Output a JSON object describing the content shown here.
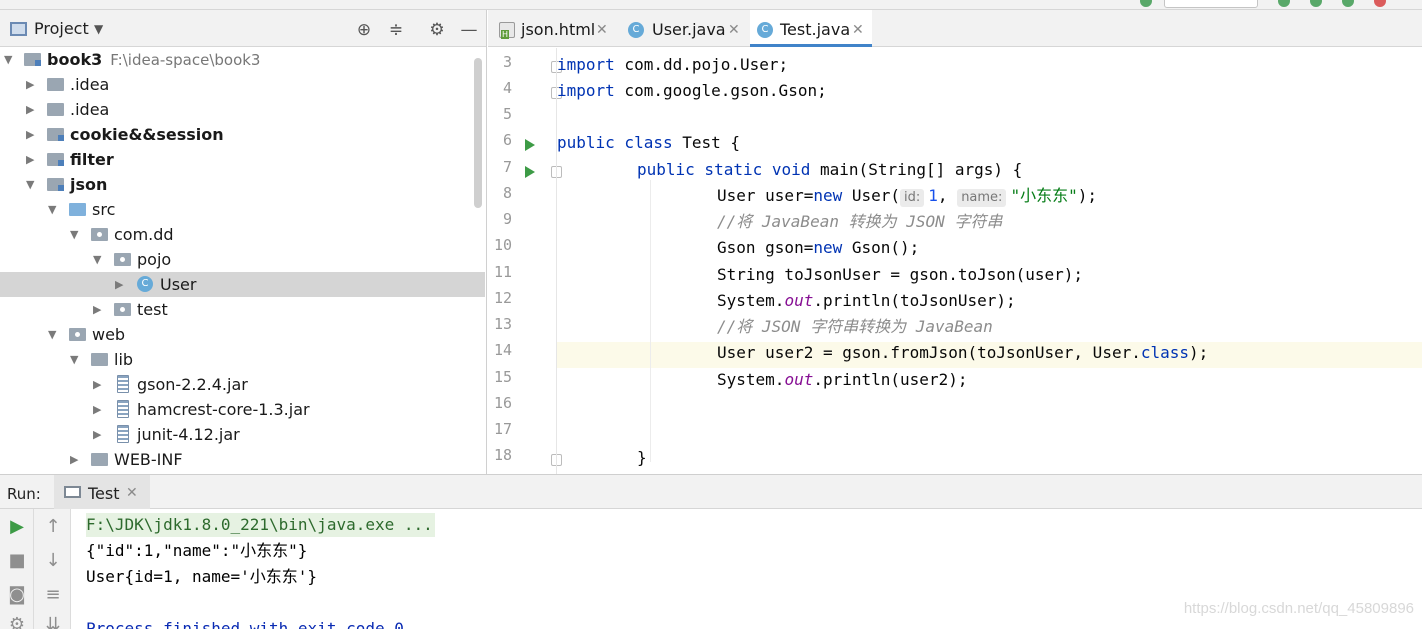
{
  "project_panel": {
    "title": "Project",
    "tree": [
      {
        "label": "book3",
        "path": "F:\\idea-space\\book3",
        "bold": true,
        "expanded": true
      },
      {
        "label": ".idea",
        "bold": false,
        "expanded": false
      },
      {
        "label": ".idea",
        "bold": false,
        "expanded": false
      },
      {
        "label": "cookie&&session",
        "bold": true,
        "expanded": false
      },
      {
        "label": "filter",
        "bold": true,
        "expanded": false
      },
      {
        "label": "json",
        "bold": true,
        "expanded": true
      },
      {
        "label": "src",
        "bold": false,
        "expanded": true
      },
      {
        "label": "com.dd",
        "bold": false,
        "expanded": true
      },
      {
        "label": "pojo",
        "bold": false,
        "expanded": true
      },
      {
        "label": "User",
        "bold": false,
        "expanded": false,
        "selected": true
      },
      {
        "label": "test",
        "bold": false,
        "expanded": false
      },
      {
        "label": "web",
        "bold": false,
        "expanded": true
      },
      {
        "label": "lib",
        "bold": false,
        "expanded": true
      },
      {
        "label": "gson-2.2.4.jar",
        "bold": false,
        "expanded": false
      },
      {
        "label": "hamcrest-core-1.3.jar",
        "bold": false,
        "expanded": false
      },
      {
        "label": "junit-4.12.jar",
        "bold": false,
        "expanded": false
      },
      {
        "label": "WEB-INF",
        "bold": false,
        "expanded": false
      }
    ]
  },
  "editor": {
    "tabs": [
      {
        "label": "json.html",
        "icon": "html-file-icon",
        "active": false
      },
      {
        "label": "User.java",
        "icon": "java-class-icon",
        "active": false
      },
      {
        "label": "Test.java",
        "icon": "java-class-icon",
        "active": true
      }
    ],
    "line_numbers": [
      "3",
      "4",
      "5",
      "6",
      "7",
      "8",
      "9",
      "10",
      "11",
      "12",
      "13",
      "14",
      "15",
      "16",
      "17",
      "18"
    ],
    "current_line": "14",
    "code": {
      "l3_kw": "import",
      "l3_rest": " com.dd.pojo.User;",
      "l4_kw": "import",
      "l4_rest": " com.google.gson.Gson;",
      "l6_kw": "public class",
      "l6_rest": " Test {",
      "l7_kw": "public static void",
      "l7_rest": " main(String[] args) {",
      "l8_a": "User user=",
      "l8_kw": "new",
      "l8_b": " User(",
      "l8_hint_id": "id:",
      "l8_num": "1",
      "l8_comma": ", ",
      "l8_hint_name": "name:",
      "l8_str": "\"小东东\"",
      "l8_end": ");",
      "l9_cmt": "//将 JavaBean 转换为 JSON 字符串",
      "l10_a": "Gson gson=",
      "l10_kw": "new",
      "l10_b": " Gson();",
      "l11": "String toJsonUser = gson.toJson(user);",
      "l12_a": "System.",
      "l12_fld": "out",
      "l12_b": ".println(toJsonUser);",
      "l13_cmt": "//将 JSON 字符串转换为 JavaBean",
      "l14_a": "User user2 = gson.fromJson(toJsonUser, User.",
      "l14_kw": "class",
      "l14_b": ");",
      "l15_a": "System.",
      "l15_fld": "out",
      "l15_b": ".println(user2);",
      "l18": "}"
    }
  },
  "run_panel": {
    "label": "Run:",
    "tab": "Test",
    "output": [
      "F:\\JDK\\jdk1.8.0_221\\bin\\java.exe ...",
      "{\"id\":1,\"name\":\"小东东\"}",
      "User{id=1, name='小东东'}",
      "",
      "Process finished with exit code 0"
    ]
  },
  "watermark": "https://blog.csdn.net/qq_45809896",
  "colors": {
    "keyword": "#0033b3",
    "string": "#067d17",
    "number": "#1750eb",
    "comment": "#8c8c8c",
    "static_field": "#871094",
    "run_green": "#3d9b46",
    "selection": "#d5d5d5",
    "current_line": "#fcfae9"
  }
}
